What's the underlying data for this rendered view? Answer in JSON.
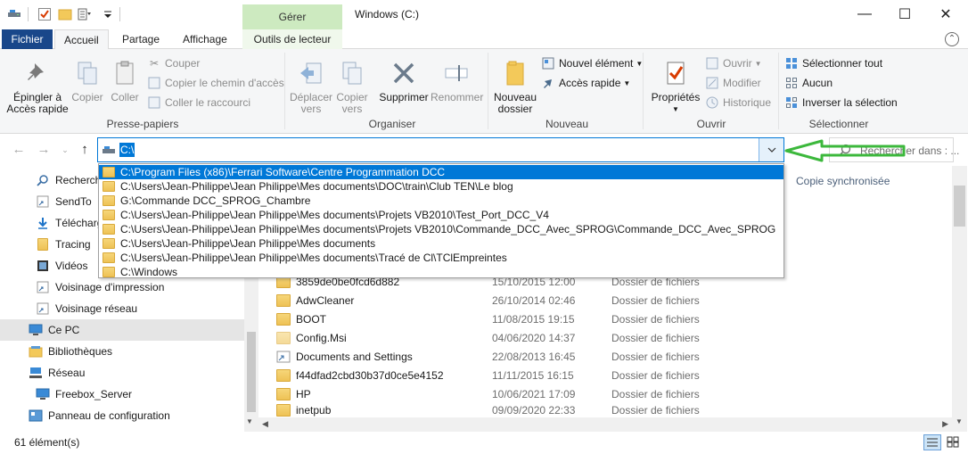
{
  "window": {
    "title": "Windows (C:)",
    "context_tab_group": "Gérer",
    "minimize": "—",
    "maximize": "☐",
    "close": "✕"
  },
  "tabs": [
    {
      "label": "Fichier"
    },
    {
      "label": "Accueil"
    },
    {
      "label": "Partage"
    },
    {
      "label": "Affichage"
    },
    {
      "label": "Outils de lecteur"
    }
  ],
  "ribbon": {
    "presse_papiers": {
      "group_label": "Presse-papiers",
      "pin_label_1": "Épingler à",
      "pin_label_2": "Accès rapide",
      "copy": "Copier",
      "paste": "Coller",
      "cut": "Couper",
      "copy_path": "Copier le chemin d'accès",
      "paste_shortcut": "Coller le raccourci"
    },
    "organiser": {
      "group_label": "Organiser",
      "move_1": "Déplacer",
      "move_2": "vers",
      "copyto_1": "Copier",
      "copyto_2": "vers",
      "delete": "Supprimer",
      "rename": "Renommer"
    },
    "nouveau": {
      "group_label": "Nouveau",
      "new_folder_1": "Nouveau",
      "new_folder_2": "dossier",
      "new_item": "Nouvel élément",
      "easy_access": "Accès rapide"
    },
    "ouvrir": {
      "group_label": "Ouvrir",
      "properties": "Propriétés",
      "open": "Ouvrir",
      "edit": "Modifier",
      "history": "Historique"
    },
    "selectionner": {
      "group_label": "Sélectionner",
      "select_all": "Sélectionner tout",
      "select_none": "Aucun",
      "invert": "Inverser la sélection"
    }
  },
  "address": {
    "value": "C:\\",
    "search_placeholder": "Rechercher dans : ..."
  },
  "dropdown_items": [
    "C:\\Program Files (x86)\\Ferrari Software\\Centre Programmation DCC",
    "C:\\Users\\Jean-Philippe\\Jean Philippe\\Mes documents\\DOC\\train\\Club TEN\\Le blog",
    "G:\\Commande DCC_SPROG_Chambre",
    "C:\\Users\\Jean-Philippe\\Jean Philippe\\Mes documents\\Projets VB2010\\Test_Port_DCC_V4",
    "C:\\Users\\Jean-Philippe\\Jean Philippe\\Mes documents\\Projets VB2010\\Commande_DCC_Avec_SPROG\\Commande_DCC_Avec_SPROG",
    "C:\\Users\\Jean-Philippe\\Jean Philippe\\Mes documents",
    "C:\\Users\\Jean-Philippe\\Jean Philippe\\Mes documents\\Tracé de Cl\\TClEmpreintes",
    "C:\\Windows"
  ],
  "nav_items": [
    {
      "label": "Recherch"
    },
    {
      "label": "SendTo"
    },
    {
      "label": "Télécharg"
    },
    {
      "label": "Tracing"
    },
    {
      "label": "Vidéos"
    },
    {
      "label": "Voisinage d'impression"
    },
    {
      "label": "Voisinage réseau"
    },
    {
      "label": "Ce PC"
    },
    {
      "label": "Bibliothèques"
    },
    {
      "label": "Réseau"
    },
    {
      "label": "Freebox_Server"
    },
    {
      "label": "Panneau de configuration"
    }
  ],
  "content": {
    "column_status": "Copie synchronisée",
    "files": [
      {
        "name": "3859de0be0fcd6d882",
        "date": "15/10/2015 12:00",
        "type": "Dossier de fichiers"
      },
      {
        "name": "AdwCleaner",
        "date": "26/10/2014 02:46",
        "type": "Dossier de fichiers"
      },
      {
        "name": "BOOT",
        "date": "11/08/2015 19:15",
        "type": "Dossier de fichiers"
      },
      {
        "name": "Config.Msi",
        "date": "04/06/2020 14:37",
        "type": "Dossier de fichiers"
      },
      {
        "name": "Documents and Settings",
        "date": "22/08/2013 16:45",
        "type": "Dossier de fichiers"
      },
      {
        "name": "f44dfad2cbd30b37d0ce5e4152",
        "date": "11/11/2015 16:15",
        "type": "Dossier de fichiers"
      },
      {
        "name": "HP",
        "date": "10/06/2021 17:09",
        "type": "Dossier de fichiers"
      },
      {
        "name": "inetpub",
        "date": "09/09/2020 22:33",
        "type": "Dossier de fichiers"
      }
    ]
  },
  "status": {
    "count": "61 élément(s)"
  },
  "colors": {
    "file_tab": "#19478a",
    "accent": "#0078d7",
    "context_tab": "#cdeac0",
    "annotation_arrow": "#3cb83c"
  }
}
